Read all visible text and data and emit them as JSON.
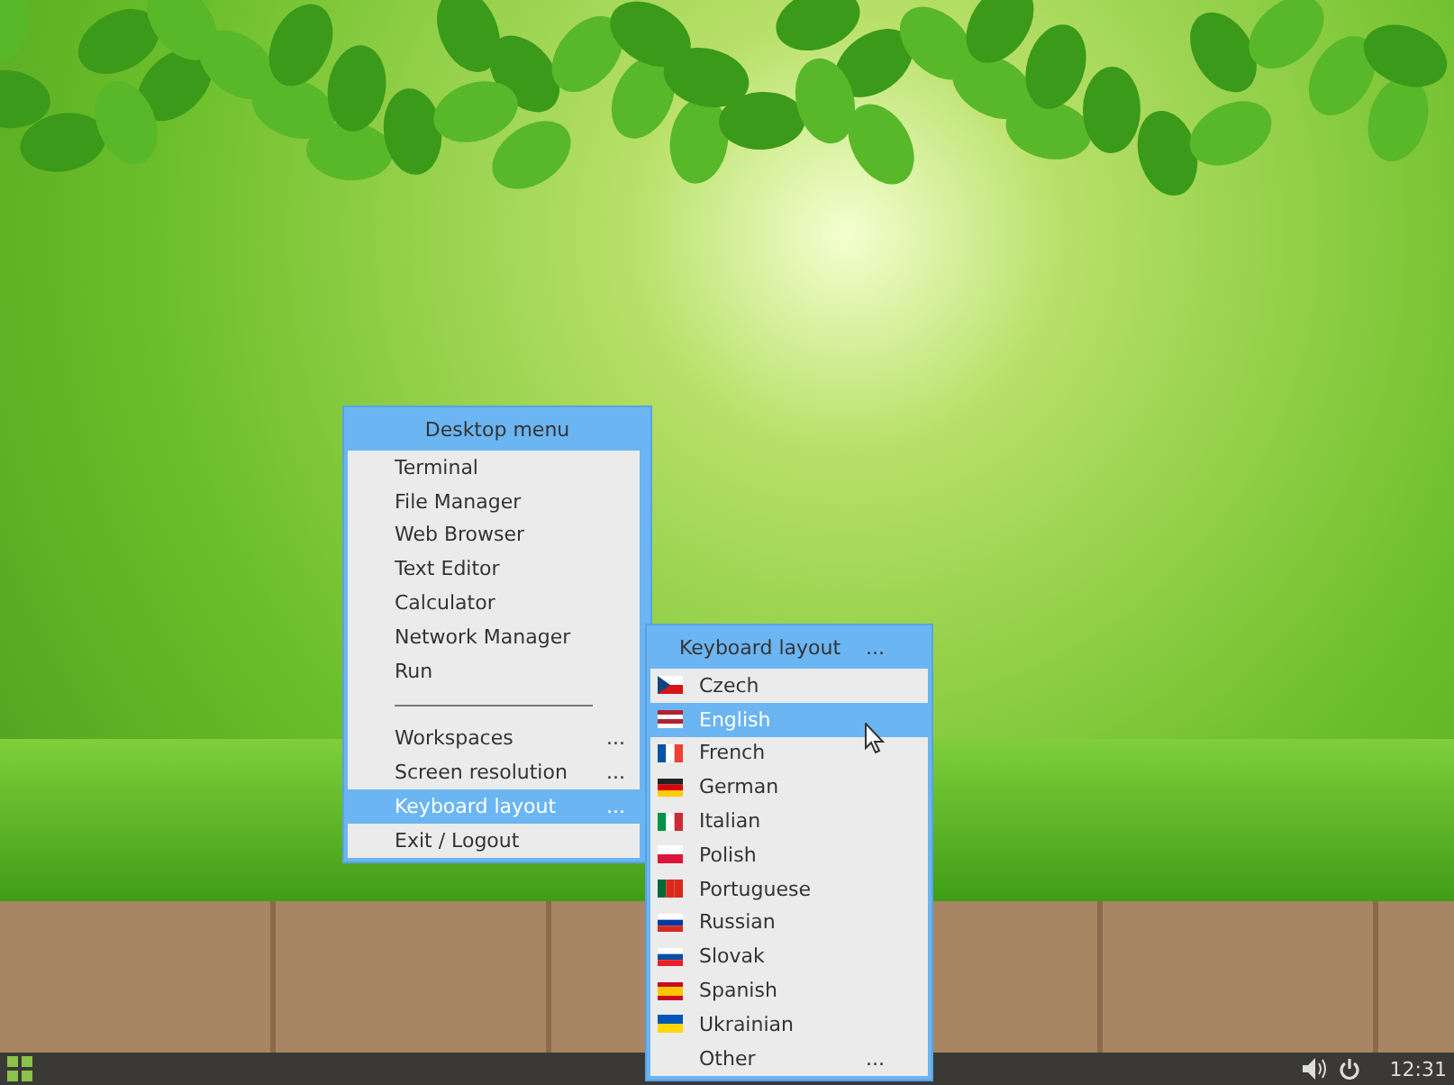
{
  "desktop_menu": {
    "title": "Desktop menu",
    "items": [
      {
        "kind": "item",
        "label": "Terminal",
        "selected": false
      },
      {
        "kind": "item",
        "label": "File Manager",
        "selected": false
      },
      {
        "kind": "item",
        "label": "Web Browser",
        "selected": false
      },
      {
        "kind": "item",
        "label": "Text Editor",
        "selected": false
      },
      {
        "kind": "item",
        "label": "Calculator",
        "selected": false
      },
      {
        "kind": "item",
        "label": "Network Manager",
        "selected": false
      },
      {
        "kind": "item",
        "label": "Run",
        "selected": false
      },
      {
        "kind": "separator"
      },
      {
        "kind": "item",
        "label": "Workspaces",
        "more": "...",
        "selected": false
      },
      {
        "kind": "item",
        "label": "Screen resolution",
        "more": "...",
        "selected": false
      },
      {
        "kind": "item",
        "label": "Keyboard layout",
        "more": "...",
        "selected": true
      },
      {
        "kind": "item",
        "label": "Exit / Logout",
        "selected": false
      }
    ]
  },
  "keyboard_menu": {
    "title": "Keyboard layout",
    "title_more": "...",
    "items": [
      {
        "kind": "flag",
        "label": "Czech",
        "selected": false
      },
      {
        "kind": "flag",
        "label": "English",
        "selected": true
      },
      {
        "kind": "flag",
        "label": "French",
        "selected": false
      },
      {
        "kind": "flag",
        "label": "German",
        "selected": false
      },
      {
        "kind": "flag",
        "label": "Italian",
        "selected": false
      },
      {
        "kind": "flag",
        "label": "Polish",
        "selected": false
      },
      {
        "kind": "flag",
        "label": "Portuguese",
        "selected": false
      },
      {
        "kind": "flag",
        "label": "Russian",
        "selected": false
      },
      {
        "kind": "flag",
        "label": "Slovak",
        "selected": false
      },
      {
        "kind": "flag",
        "label": "Spanish",
        "selected": false
      },
      {
        "kind": "flag",
        "label": "Ukrainian",
        "selected": false
      },
      {
        "kind": "plain",
        "label": "Other",
        "more": "...",
        "selected": false
      }
    ]
  },
  "taskbar": {
    "clock": "12:31"
  }
}
